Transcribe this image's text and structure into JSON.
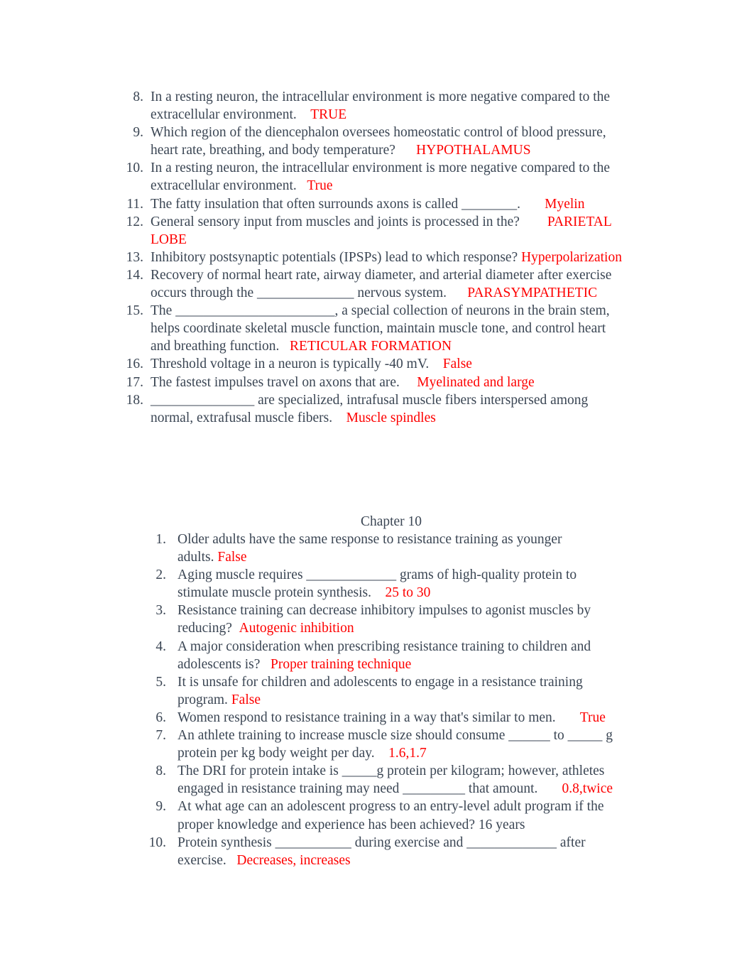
{
  "document": {
    "text_color": "#3b4654",
    "answer_color": "#fe0000"
  },
  "section_a": {
    "name": "neurophysiology-questions-continued",
    "items": [
      {
        "number": "8.",
        "question": "In a resting neuron, the intracellular environment is more negative compared to the extracellular environment.",
        "gap": "    ",
        "answer": "TRUE"
      },
      {
        "number": "9.",
        "question": "Which region of the diencephalon oversees homeostatic control of blood pressure, heart rate, breathing, and body temperature?",
        "gap": "      ",
        "answer": "HYPOTHALAMUS"
      },
      {
        "number": "10.",
        "question": "In a resting neuron, the intracellular environment is more negative compared to the extracellular environment.",
        "gap": "   ",
        "answer": "True"
      },
      {
        "number": "11.",
        "question": "The fatty insulation that often surrounds axons is called ________.",
        "gap": "       ",
        "answer": "Myelin"
      },
      {
        "number": "12.",
        "question": "General sensory input from muscles and joints is processed in the?",
        "gap": "        ",
        "answer": "PARIETAL LOBE"
      },
      {
        "number": "13.",
        "question": "Inhibitory postsynaptic potentials (IPSPs) lead to which response?",
        "gap": " ",
        "answer": "Hyperpolarization"
      },
      {
        "number": "14.",
        "question": "Recovery of normal heart rate, airway diameter, and arterial diameter after exercise occurs through the ______________ nervous system.",
        "gap": "      ",
        "answer": "PARASYMPATHETIC"
      },
      {
        "number": "15.",
        "question": "The _______________________, a special collection of neurons in the brain stem, helps coordinate skeletal muscle function, maintain muscle tone, and control heart and breathing function.",
        "gap": "   ",
        "answer": "RETICULAR FORMATION"
      },
      {
        "number": "16.",
        "question": "Threshold voltage in a neuron is typically -40 mV.",
        "gap": "    ",
        "answer": "False"
      },
      {
        "number": "17.",
        "question": "The fastest impulses travel on axons that are.",
        "gap": "     ",
        "answer": "Myelinated and large"
      },
      {
        "number": "18.",
        "question": "_______________ are specialized, intrafusal muscle fibers interspersed among normal, extrafusal muscle fibers.",
        "gap": "    ",
        "answer": "Muscle spindles"
      }
    ]
  },
  "section_b": {
    "name": "chapter-10-questions",
    "heading": "Chapter 10",
    "items": [
      {
        "number": "1.",
        "question": "Older adults have the same response to resistance training as younger adults.",
        "gap": " ",
        "answer": "False"
      },
      {
        "number": "2.",
        "question": "Aging muscle requires _____________ grams of high-quality protein to stimulate muscle protein synthesis.",
        "gap": "    ",
        "answer": "25 to 30"
      },
      {
        "number": "3.",
        "question": "Resistance training can decrease inhibitory impulses to agonist muscles by reducing?",
        "gap": "  ",
        "answer": "Autogenic inhibition"
      },
      {
        "number": "4.",
        "question": "A major consideration when prescribing resistance training to children and adolescents is?",
        "gap": "   ",
        "answer": "Proper training technique"
      },
      {
        "number": "5.",
        "question": "It is unsafe for children and adolescents to engage in a resistance training program.",
        "gap": " ",
        "answer": "False"
      },
      {
        "number": "6.",
        "question": "Women respond to resistance training in a way that's similar to men.",
        "gap": "       ",
        "answer": "True"
      },
      {
        "number": "7.",
        "question": "An athlete training to increase muscle size should consume ______ to _____ g protein per kg body weight per day.",
        "gap": "    ",
        "answer": "1.6,1.7"
      },
      {
        "number": "8.",
        "question": "The DRI for protein intake is _____g protein per kilogram; however, athletes engaged in resistance training may need _________ that amount.",
        "gap": "       ",
        "answer": "0.8,twice"
      },
      {
        "number": "9.",
        "question": "At what age can an adolescent progress to an entry-level adult program if the proper knowledge and experience has been achieved? 16 years",
        "gap": "",
        "answer": ""
      },
      {
        "number": "10.",
        "question": "Protein synthesis ___________ during exercise and _____________ after exercise.",
        "gap": "   ",
        "answer": "Decreases, increases"
      }
    ]
  }
}
